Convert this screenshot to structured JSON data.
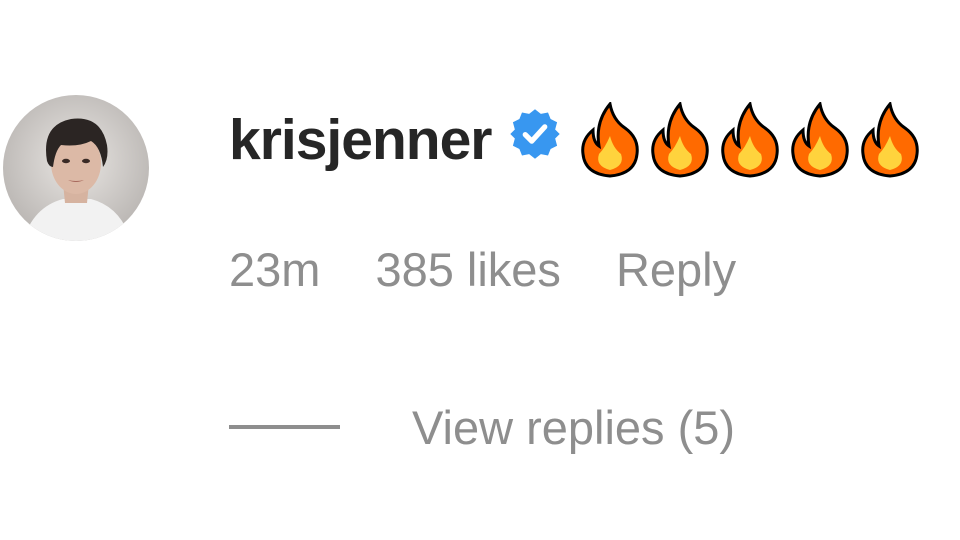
{
  "comment": {
    "username": "krisjenner",
    "verified_icon": "verified-badge-icon",
    "text_icons": [
      "fire-emoji",
      "fire-emoji",
      "fire-emoji",
      "fire-emoji",
      "fire-emoji"
    ],
    "timestamp": "23m",
    "likes": "385 likes",
    "reply_label": "Reply",
    "view_replies_label": "View replies (5)"
  },
  "colors": {
    "username": "#262626",
    "meta_text": "#8e8e8e",
    "verified_blue": "#3897f0"
  }
}
